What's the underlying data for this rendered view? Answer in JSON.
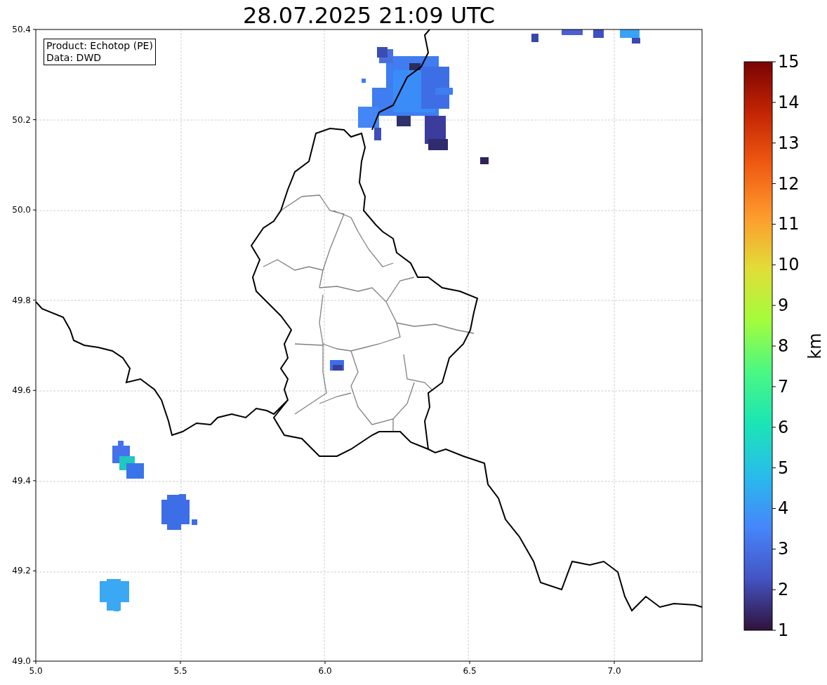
{
  "title": "28.07.2025 21:09 UTC",
  "info_box": [
    "Product: Echotop (PE)",
    "Data: DWD"
  ],
  "x_ticks": [
    "5.0",
    "5.5",
    "6.0",
    "6.5",
    "7.0"
  ],
  "y_ticks": [
    "50.4",
    "50.2",
    "50.0",
    "49.8",
    "49.6",
    "49.4",
    "49.2",
    "49.0"
  ],
  "colorbar": {
    "label": "km",
    "ticks": [
      "15",
      "14",
      "13",
      "12",
      "11",
      "10",
      "9",
      "8",
      "7",
      "6",
      "5",
      "4",
      "3",
      "2",
      "1"
    ]
  }
}
